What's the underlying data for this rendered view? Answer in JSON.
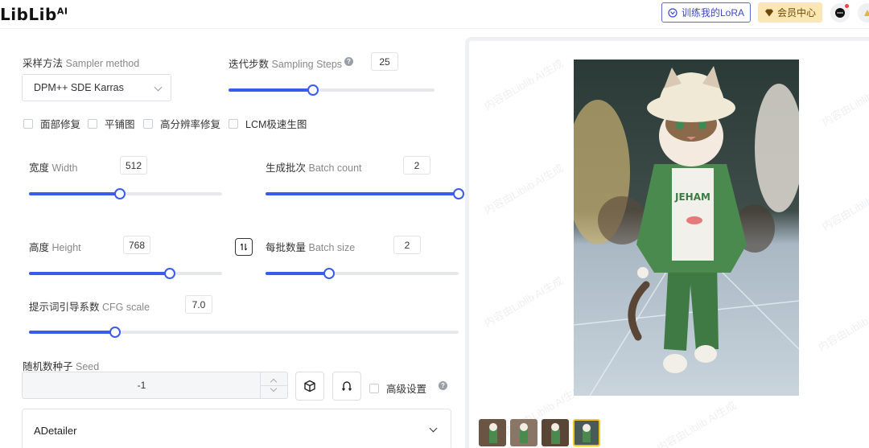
{
  "header": {
    "logo": "LibLib",
    "logo_sup": "AI",
    "lora_button": "训练我的LoRA",
    "vip_button": "会员中心"
  },
  "sampler": {
    "label_cn": "采样方法",
    "label_en": "Sampler method",
    "value": "DPM++ SDE Karras"
  },
  "steps": {
    "label_cn": "迭代步数",
    "label_en": "Sampling Steps",
    "value": "25",
    "fraction": 0.41
  },
  "checkboxes": [
    "面部修复",
    "平铺图",
    "高分辨率修复",
    "LCM极速生图"
  ],
  "width": {
    "label_cn": "宽度",
    "label_en": "Width",
    "value": "512",
    "fraction": 0.47
  },
  "batch_count": {
    "label_cn": "生成批次",
    "label_en": "Batch count",
    "value": "2",
    "fraction": 1.0
  },
  "height": {
    "label_cn": "高度",
    "label_en": "Height",
    "value": "768",
    "fraction": 0.73
  },
  "batch_size": {
    "label_cn": "每批数量",
    "label_en": "Batch size",
    "value": "2",
    "fraction": 0.33
  },
  "cfg": {
    "label_cn": "提示词引导系数",
    "label_en": "CFG scale",
    "value": "7.0",
    "fraction": 0.2
  },
  "seed": {
    "label_cn": "随机数种子",
    "label_en": "Seed",
    "value": "-1"
  },
  "advanced": {
    "label": "高级设置"
  },
  "adetailer": {
    "label": "ADetailer"
  },
  "watermark": "内容由Liblib AI生成",
  "colors": {
    "accent": "#3a5bf0",
    "vip_bg": "#fbe7b3",
    "lora_border": "#5b6bd6"
  }
}
